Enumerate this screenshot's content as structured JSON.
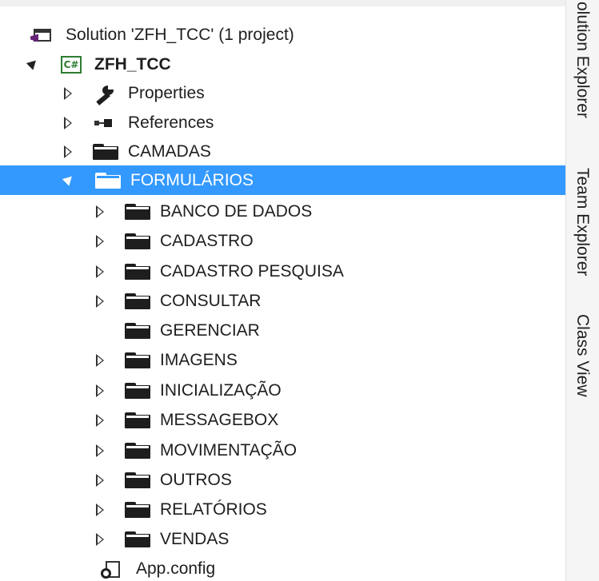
{
  "solution": {
    "label": "Solution 'ZFH_TCC' (1 project)",
    "icon": "solution-icon"
  },
  "project": {
    "label": "ZFH_TCC",
    "icon": "csharp-project-icon",
    "icon_text": "C#"
  },
  "items": {
    "properties": "Properties",
    "references": "References",
    "camadas": "CAMADAS",
    "formularios": "FORMULÁRIOS",
    "appconfig": "App.config"
  },
  "formularios_children": [
    "BANCO DE DADOS",
    "CADASTRO",
    "CADASTRO PESQUISA",
    "CONSULTAR",
    "GERENCIAR",
    "IMAGENS",
    "INICIALIZAÇÃO",
    "MESSAGEBOX",
    "MOVIMENTAÇÃO",
    "OUTROS",
    "RELATÓRIOS",
    "VENDAS"
  ],
  "side_tabs": {
    "solution_explorer": "olution Explorer",
    "team_explorer": "Team Explorer",
    "class_view": "Class View"
  },
  "colors": {
    "selection": "#3399ff",
    "text": "#1e1e1e",
    "csharp": "#2e7d32"
  }
}
